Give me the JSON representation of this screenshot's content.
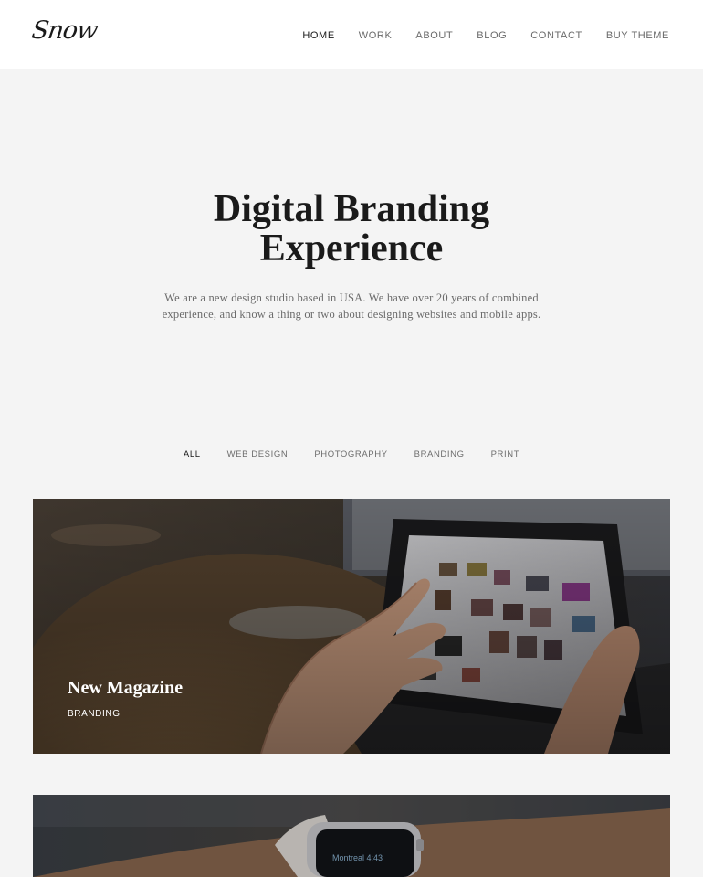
{
  "header": {
    "logo_text": "Snow",
    "nav": [
      {
        "label": "HOME",
        "active": true
      },
      {
        "label": "WORK",
        "active": false
      },
      {
        "label": "ABOUT",
        "active": false
      },
      {
        "label": "BLOG",
        "active": false
      },
      {
        "label": "CONTACT",
        "active": false
      },
      {
        "label": "BUY THEME",
        "active": false
      }
    ]
  },
  "hero": {
    "title_line1": "Digital Branding",
    "title_line2": "Experience",
    "subtitle": "We are a new design studio based in USA. We have over 20 years of combined experience, and know a thing or two about designing websites and mobile apps."
  },
  "filters": [
    {
      "label": "ALL",
      "active": true
    },
    {
      "label": "WEB DESIGN",
      "active": false
    },
    {
      "label": "PHOTOGRAPHY",
      "active": false
    },
    {
      "label": "BRANDING",
      "active": false
    },
    {
      "label": "PRINT",
      "active": false
    }
  ],
  "portfolio": [
    {
      "title": "New Magazine",
      "category": "BRANDING",
      "image": "tablet-hands-photo"
    },
    {
      "title": "",
      "category": "",
      "image": "smartwatch-wrist-photo",
      "watch_text": "Montreal 4:43"
    }
  ],
  "colors": {
    "page_background": "#f4f4f4",
    "header_background": "#ffffff",
    "text_dark": "#1a1a1a",
    "text_muted": "#6b6b6b"
  }
}
